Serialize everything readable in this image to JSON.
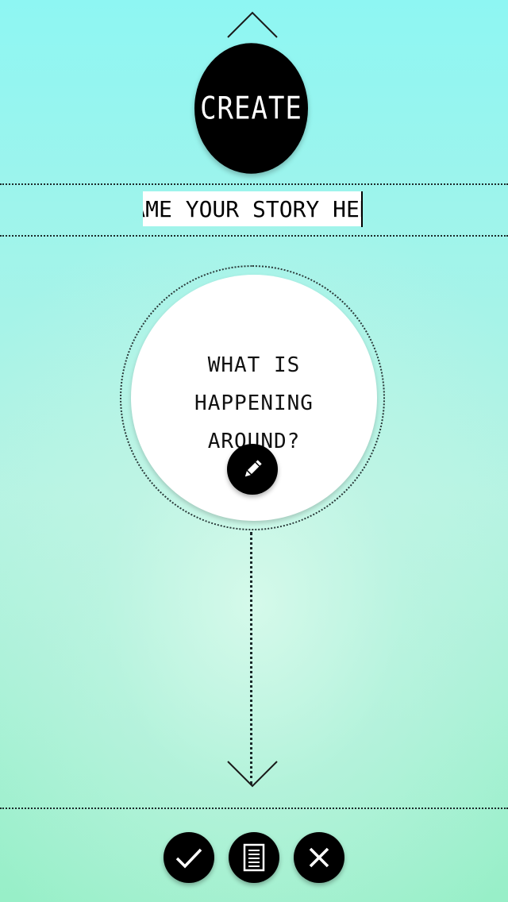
{
  "header": {
    "up_icon": "chevron-up-icon",
    "create_label": "CREATE"
  },
  "title_input": {
    "placeholder": "NAME YOUR STORY HERE",
    "value": ""
  },
  "prompt": {
    "text": "WHAT IS HAPPENING AROUND?",
    "edit_icon": "pencil-icon"
  },
  "navigation": {
    "down_icon": "chevron-down-icon"
  },
  "footer": {
    "buttons": [
      {
        "name": "confirm",
        "icon": "checkmark-icon"
      },
      {
        "name": "pages",
        "icon": "document-icon"
      },
      {
        "name": "close",
        "icon": "close-icon"
      }
    ]
  },
  "colors": {
    "background_top": "#8ef6f3",
    "background_bottom": "#98efc8",
    "button": "#000000",
    "circle": "#ffffff"
  }
}
